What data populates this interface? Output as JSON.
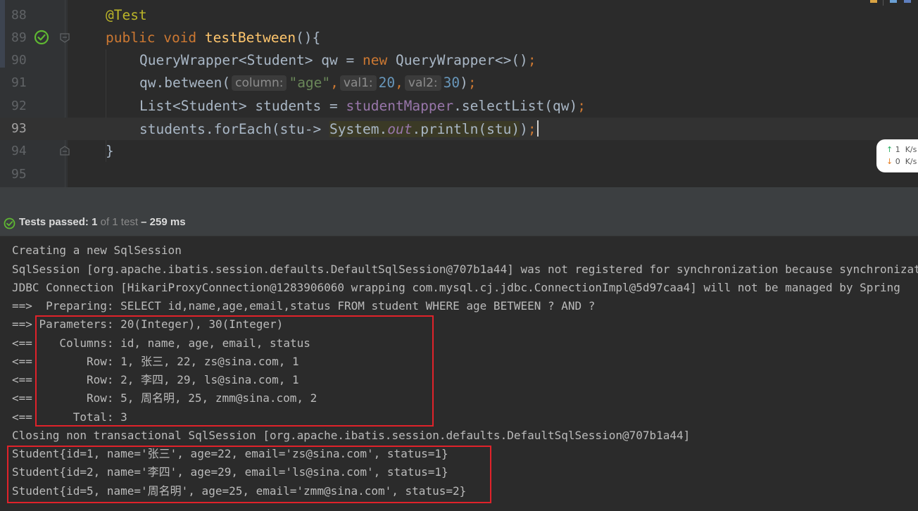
{
  "editor": {
    "lines": [
      {
        "num": "88"
      },
      {
        "num": "89"
      },
      {
        "num": "90"
      },
      {
        "num": "91"
      },
      {
        "num": "92"
      },
      {
        "num": "93"
      },
      {
        "num": "94"
      },
      {
        "num": "95"
      }
    ],
    "code": {
      "l88_annotation": "@Test",
      "l89_public": "public",
      "l89_void": "void",
      "l89_method": "testBetween",
      "l89_rest": "(){",
      "l90_type": "QueryWrapper<Student> qw = ",
      "l90_new": "new",
      "l90_ctor": " QueryWrapper<>()",
      "l90_semi": ";",
      "l91_call": "qw.between(",
      "l91_hint1": "column:",
      "l91_str": "\"age\"",
      "l91_comma1": ",",
      "l91_hint2": "val1:",
      "l91_num1": "20",
      "l91_comma2": ",",
      "l91_hint3": "val2:",
      "l91_num2": "30",
      "l91_close": ")",
      "l91_semi": ";",
      "l92_type": "List<Student> students = ",
      "l92_field": "studentMapper",
      "l92_call": ".selectList(qw)",
      "l92_semi": ";",
      "l93_start": "students.forEach(stu-> ",
      "l93_system": "System.",
      "l93_out": "out",
      "l93_println": ".println(stu)",
      "l93_close": ")",
      "l93_semi": ";",
      "l94_brace": "}"
    },
    "network": {
      "up_value": "1",
      "up_unit": "K/s",
      "down_value": "0",
      "down_unit": "K/s"
    }
  },
  "status": {
    "label": "Tests passed: ",
    "passed": "1",
    "of_text": " of 1 test",
    "duration": " – 259 ms"
  },
  "console": {
    "lines": [
      "Creating a new SqlSession",
      "SqlSession [org.apache.ibatis.session.defaults.DefaultSqlSession@707b1a44] was not registered for synchronization because synchronization is not active",
      "JDBC Connection [HikariProxyConnection@1283906060 wrapping com.mysql.cj.jdbc.ConnectionImpl@5d97caa4] will not be managed by Spring",
      "==>  Preparing: SELECT id,name,age,email,status FROM student WHERE age BETWEEN ? AND ?",
      "==> Parameters: 20(Integer), 30(Integer)",
      "<==    Columns: id, name, age, email, status",
      "<==        Row: 1, 张三, 22, zs@sina.com, 1",
      "<==        Row: 2, 李四, 29, ls@sina.com, 1",
      "<==        Row: 5, 周名明, 25, zmm@sina.com, 2",
      "<==      Total: 3",
      "Closing non transactional SqlSession [org.apache.ibatis.session.defaults.DefaultSqlSession@707b1a44]",
      "Student{id=1, name='张三', age=22, email='zs@sina.com', status=1}",
      "Student{id=2, name='李四', age=29, email='ls@sina.com', status=1}",
      "Student{id=5, name='周名明', age=25, email='zmm@sina.com', status=2}"
    ]
  },
  "colors": {
    "editor_bg": "#2b2b2b",
    "keyword": "#cc7832",
    "annotation": "#bbb529",
    "method": "#ffc66d",
    "string": "#6a8759",
    "number": "#6897bb",
    "field": "#9876aa",
    "highlight_box": "#e0222a",
    "pass_green": "#5fb832"
  }
}
